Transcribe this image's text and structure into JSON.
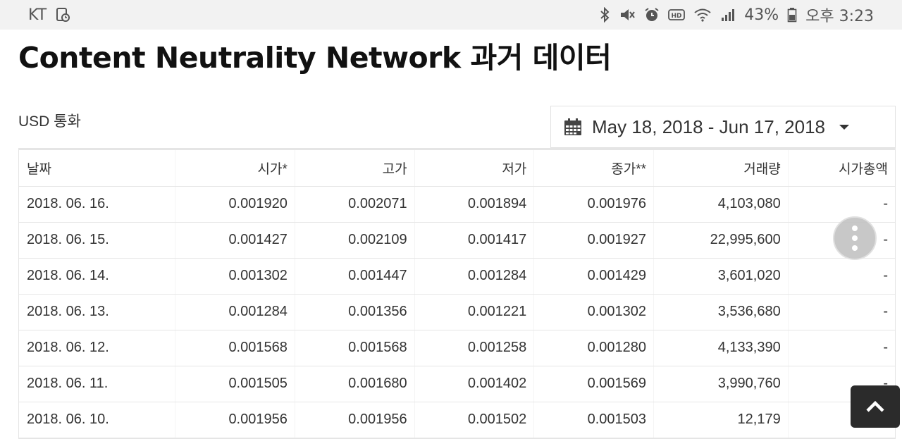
{
  "status_bar": {
    "carrier": "KT",
    "battery": "43%",
    "time": "오후 3:23"
  },
  "page": {
    "title": "Content Neutrality Network 과거 데이터",
    "currency_label": "USD 통화",
    "date_range": "May 18, 2018 - Jun 17, 2018"
  },
  "table": {
    "headers": [
      "날짜",
      "시가*",
      "고가",
      "저가",
      "종가**",
      "거래량",
      "시가총액"
    ],
    "rows": [
      [
        "2018. 06. 16.",
        "0.001920",
        "0.002071",
        "0.001894",
        "0.001976",
        "4,103,080",
        "-"
      ],
      [
        "2018. 06. 15.",
        "0.001427",
        "0.002109",
        "0.001417",
        "0.001927",
        "22,995,600",
        "-"
      ],
      [
        "2018. 06. 14.",
        "0.001302",
        "0.001447",
        "0.001284",
        "0.001429",
        "3,601,020",
        "-"
      ],
      [
        "2018. 06. 13.",
        "0.001284",
        "0.001356",
        "0.001221",
        "0.001302",
        "3,536,680",
        "-"
      ],
      [
        "2018. 06. 12.",
        "0.001568",
        "0.001568",
        "0.001258",
        "0.001280",
        "4,133,390",
        "-"
      ],
      [
        "2018. 06. 11.",
        "0.001505",
        "0.001680",
        "0.001402",
        "0.001569",
        "3,990,760",
        "-"
      ],
      [
        "2018. 06. 10.",
        "0.001956",
        "0.001956",
        "0.001502",
        "0.001503",
        "12,179",
        "-"
      ]
    ]
  },
  "icons": {
    "status_left": [
      "screenshot-icon"
    ],
    "status_right": [
      "bluetooth-icon",
      "vibrate-icon",
      "alarm-icon",
      "hd-icon",
      "wifi-icon",
      "signal-icon",
      "battery-icon"
    ],
    "date_picker": "calendar-icon",
    "fab_more": "more-vertical-icon",
    "fab_top": "scroll-top-icon"
  }
}
